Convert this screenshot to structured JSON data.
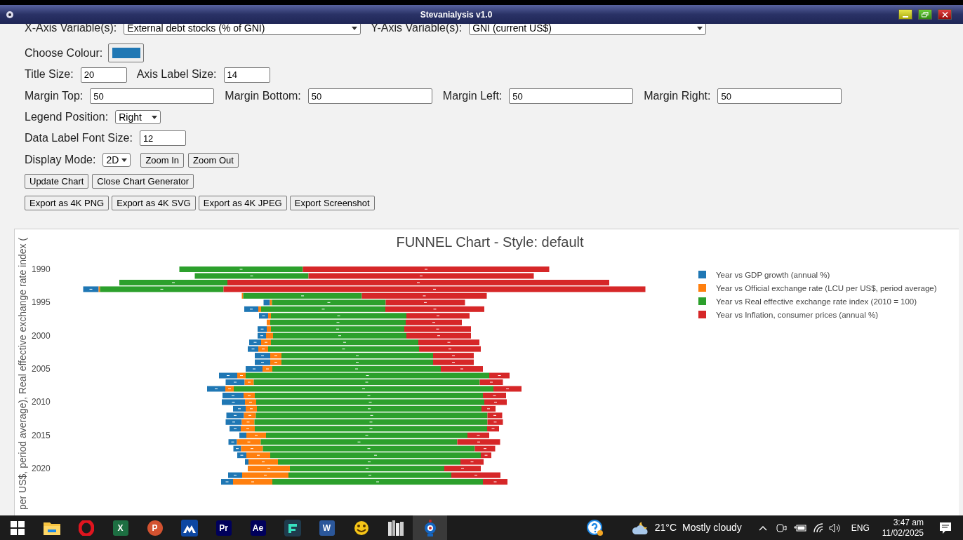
{
  "window": {
    "title": "Stevanialysis v1.0"
  },
  "x_axis": {
    "label": "X-Axis Variable(s):",
    "value": "External debt stocks (% of GNI)"
  },
  "y_axis": {
    "label": "Y-Axis Variable(s):",
    "value": "GNI (current US$)"
  },
  "colour": {
    "label": "Choose Colour:",
    "color": "#1f77b4"
  },
  "title_size": {
    "label": "Title Size:",
    "value": "20"
  },
  "axis_label_size": {
    "label": "Axis Label Size:",
    "value": "14"
  },
  "margins": [
    {
      "label": "Margin Top:",
      "value": "50"
    },
    {
      "label": "Margin Bottom:",
      "value": "50"
    },
    {
      "label": "Margin Left:",
      "value": "50"
    },
    {
      "label": "Margin Right:",
      "value": "50"
    }
  ],
  "legend_position": {
    "label": "Legend Position:",
    "value": "Right"
  },
  "data_label_font_size": {
    "label": "Data Label Font Size:",
    "value": "12"
  },
  "display_mode": {
    "label": "Display Mode:",
    "value": "2D"
  },
  "zoom_buttons": [
    "Zoom In",
    "Zoom Out"
  ],
  "action_buttons": [
    "Update Chart",
    "Close Chart Generator"
  ],
  "export_buttons": [
    "Export as 4K PNG",
    "Export as 4K SVG",
    "Export as 4K JPEG",
    "Export Screenshot"
  ],
  "chart": {
    "title": "FUNNEL Chart - Style: default",
    "y_axis_title": "per US$, period average), Real effective exchange rate index (",
    "y_ticks": [
      "1990",
      "1995",
      "2000",
      "2005",
      "2010",
      "2015",
      "2020"
    ],
    "legend": [
      {
        "label": "Year vs GDP growth (annual %)",
        "color": "#1f77b4"
      },
      {
        "label": "Year vs Official exchange rate (LCU per US$, period average)",
        "color": "#ff7f0e"
      },
      {
        "label": "Year vs Real effective exchange rate index (2010 = 100)",
        "color": "#2ca02c"
      },
      {
        "label": "Year vs Inflation, consumer prices (annual %)",
        "color": "#d62728"
      }
    ]
  },
  "taskbar": {
    "apps": [
      {
        "kind": "start",
        "active": false
      },
      {
        "kind": "folder",
        "active": false
      },
      {
        "kind": "browser",
        "active": false
      },
      {
        "kind": "tile",
        "label": "X",
        "color": "#1d6f42",
        "active": false
      },
      {
        "kind": "round",
        "label": "P",
        "color": "#d35230",
        "active": false
      },
      {
        "kind": "mountain",
        "active": false
      },
      {
        "kind": "tile",
        "label": "Pr",
        "color": "#00005b",
        "active": false
      },
      {
        "kind": "tile",
        "label": "Ae",
        "color": "#00005b",
        "active": false
      },
      {
        "kind": "editor",
        "active": false
      },
      {
        "kind": "tile",
        "label": "W",
        "color": "#2b579a",
        "active": false
      },
      {
        "kind": "smiley",
        "active": false
      },
      {
        "kind": "books",
        "active": false
      },
      {
        "kind": "robot",
        "active": true
      }
    ],
    "tray": {
      "temperature": "21°C",
      "weather": "Mostly cloudy",
      "language": "ENG",
      "time": "3:47 am",
      "date": "11/02/2025"
    }
  }
}
